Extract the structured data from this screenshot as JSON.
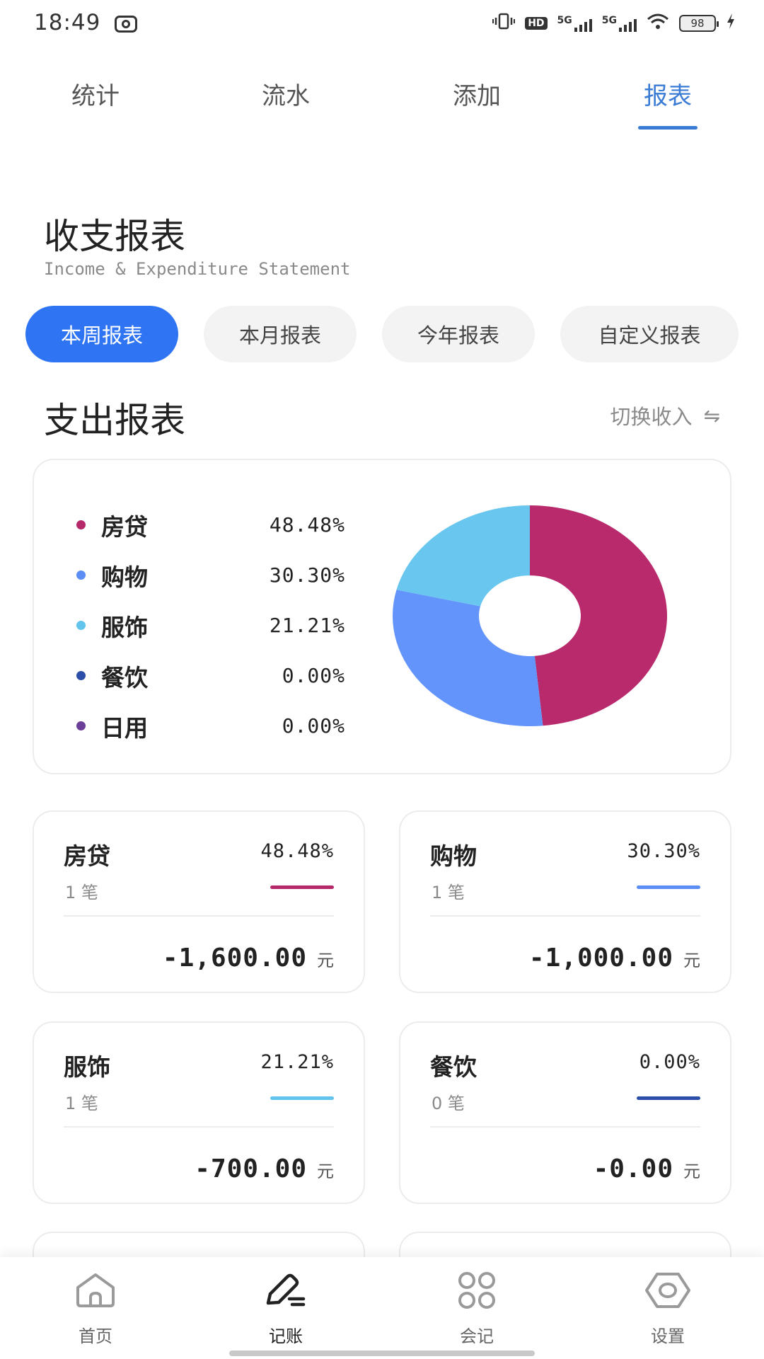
{
  "status_bar": {
    "time": "18:49",
    "hd_label": "HD",
    "net1": "5G",
    "net2": "5G",
    "battery": "98"
  },
  "top_tabs": [
    {
      "label": "统计",
      "active": false
    },
    {
      "label": "流水",
      "active": false
    },
    {
      "label": "添加",
      "active": false
    },
    {
      "label": "报表",
      "active": true
    }
  ],
  "header": {
    "title": "收支报表",
    "subtitle": "Income & Expenditure Statement"
  },
  "periods": [
    {
      "label": "本周报表",
      "active": true
    },
    {
      "label": "本月报表",
      "active": false
    },
    {
      "label": "今年报表",
      "active": false
    },
    {
      "label": "自定义报表",
      "active": false
    }
  ],
  "section": {
    "title": "支出报表",
    "switch_label": "切换收入",
    "switch_icon": "⇋"
  },
  "legend": [
    {
      "name": "房贷",
      "value": "48.48%",
      "color": "#b5296b"
    },
    {
      "name": "购物",
      "value": "30.30%",
      "color": "#5b8df5"
    },
    {
      "name": "服饰",
      "value": "21.21%",
      "color": "#62c3ec"
    },
    {
      "name": "餐饮",
      "value": "0.00%",
      "color": "#2b4fa8"
    },
    {
      "name": "日用",
      "value": "0.00%",
      "color": "#6b3f98"
    }
  ],
  "chart_data": {
    "type": "pie",
    "donut": true,
    "categories": [
      "房贷",
      "购物",
      "服饰",
      "餐饮",
      "日用"
    ],
    "values": [
      48.48,
      30.3,
      21.21,
      0.0,
      0.0
    ],
    "colors": [
      "#b82a6c",
      "#6294fb",
      "#69c7ef",
      "#2b4fa8",
      "#6b3f98"
    ]
  },
  "cards": [
    {
      "name": "房贷",
      "percent": "48.48%",
      "count": "1 笔",
      "amount": "-1,600.00",
      "unit": "元",
      "color": "#b5296b"
    },
    {
      "name": "购物",
      "percent": "30.30%",
      "count": "1 笔",
      "amount": "-1,000.00",
      "unit": "元",
      "color": "#5b8df5"
    },
    {
      "name": "服饰",
      "percent": "21.21%",
      "count": "1 笔",
      "amount": "-700.00",
      "unit": "元",
      "color": "#62c3ec"
    },
    {
      "name": "餐饮",
      "percent": "0.00%",
      "count": "0 笔",
      "amount": "-0.00",
      "unit": "元",
      "color": "#2b4fa8"
    }
  ],
  "bottom_nav": [
    {
      "label": "首页",
      "icon": "home-icon",
      "active": false
    },
    {
      "label": "记账",
      "icon": "edit-icon",
      "active": true
    },
    {
      "label": "会记",
      "icon": "grid-icon",
      "active": false
    },
    {
      "label": "设置",
      "icon": "settings-icon",
      "active": false
    }
  ]
}
